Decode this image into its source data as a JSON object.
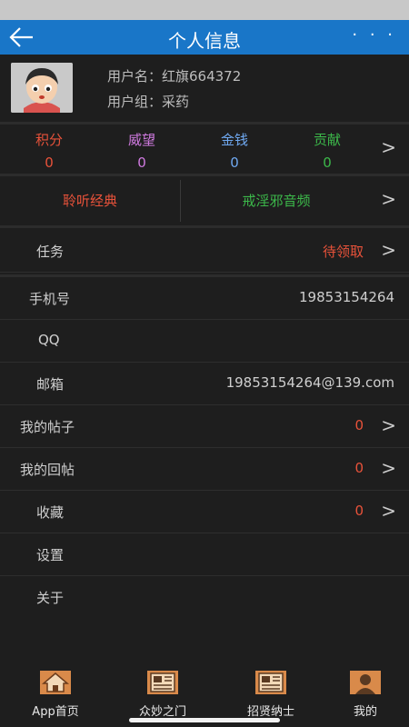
{
  "nav": {
    "title": "个人信息",
    "more": "· · ·"
  },
  "profile": {
    "username": "用户名：红旗664372",
    "group": "用户组：采药"
  },
  "stats": [
    {
      "label": "积分",
      "value": "0",
      "color": "#e8523a"
    },
    {
      "label": "威望",
      "value": "0",
      "color": "#d07ae0"
    },
    {
      "label": "金钱",
      "value": "0",
      "color": "#6fa8f0"
    },
    {
      "label": "贡献",
      "value": "0",
      "color": "#3cb84a"
    }
  ],
  "chevron": ">",
  "media": {
    "left": "聆听经典",
    "right": "戒淫邪音频",
    "left_color": "#e8523a",
    "right_color": "#3cb84a"
  },
  "rows": {
    "task": {
      "label": "任务",
      "value": "待领取"
    },
    "phone": {
      "label": "手机号",
      "value": "19853154264"
    },
    "qq": {
      "label": "QQ",
      "value": ""
    },
    "email": {
      "label": "邮箱",
      "value": "19853154264@139.com"
    },
    "posts": {
      "label": "我的帖子",
      "value": "0"
    },
    "replies": {
      "label": "我的回帖",
      "value": "0"
    },
    "favorites": {
      "label": "收藏",
      "value": "0"
    },
    "settings": {
      "label": "设置"
    },
    "about": {
      "label": "关于"
    }
  },
  "tabs": [
    {
      "label": "App首页",
      "icon": "home-icon"
    },
    {
      "label": "众妙之门",
      "icon": "newspaper-icon"
    },
    {
      "label": "招贤纳士",
      "icon": "newspaper-icon"
    },
    {
      "label": "我的",
      "icon": "profile-icon"
    }
  ]
}
